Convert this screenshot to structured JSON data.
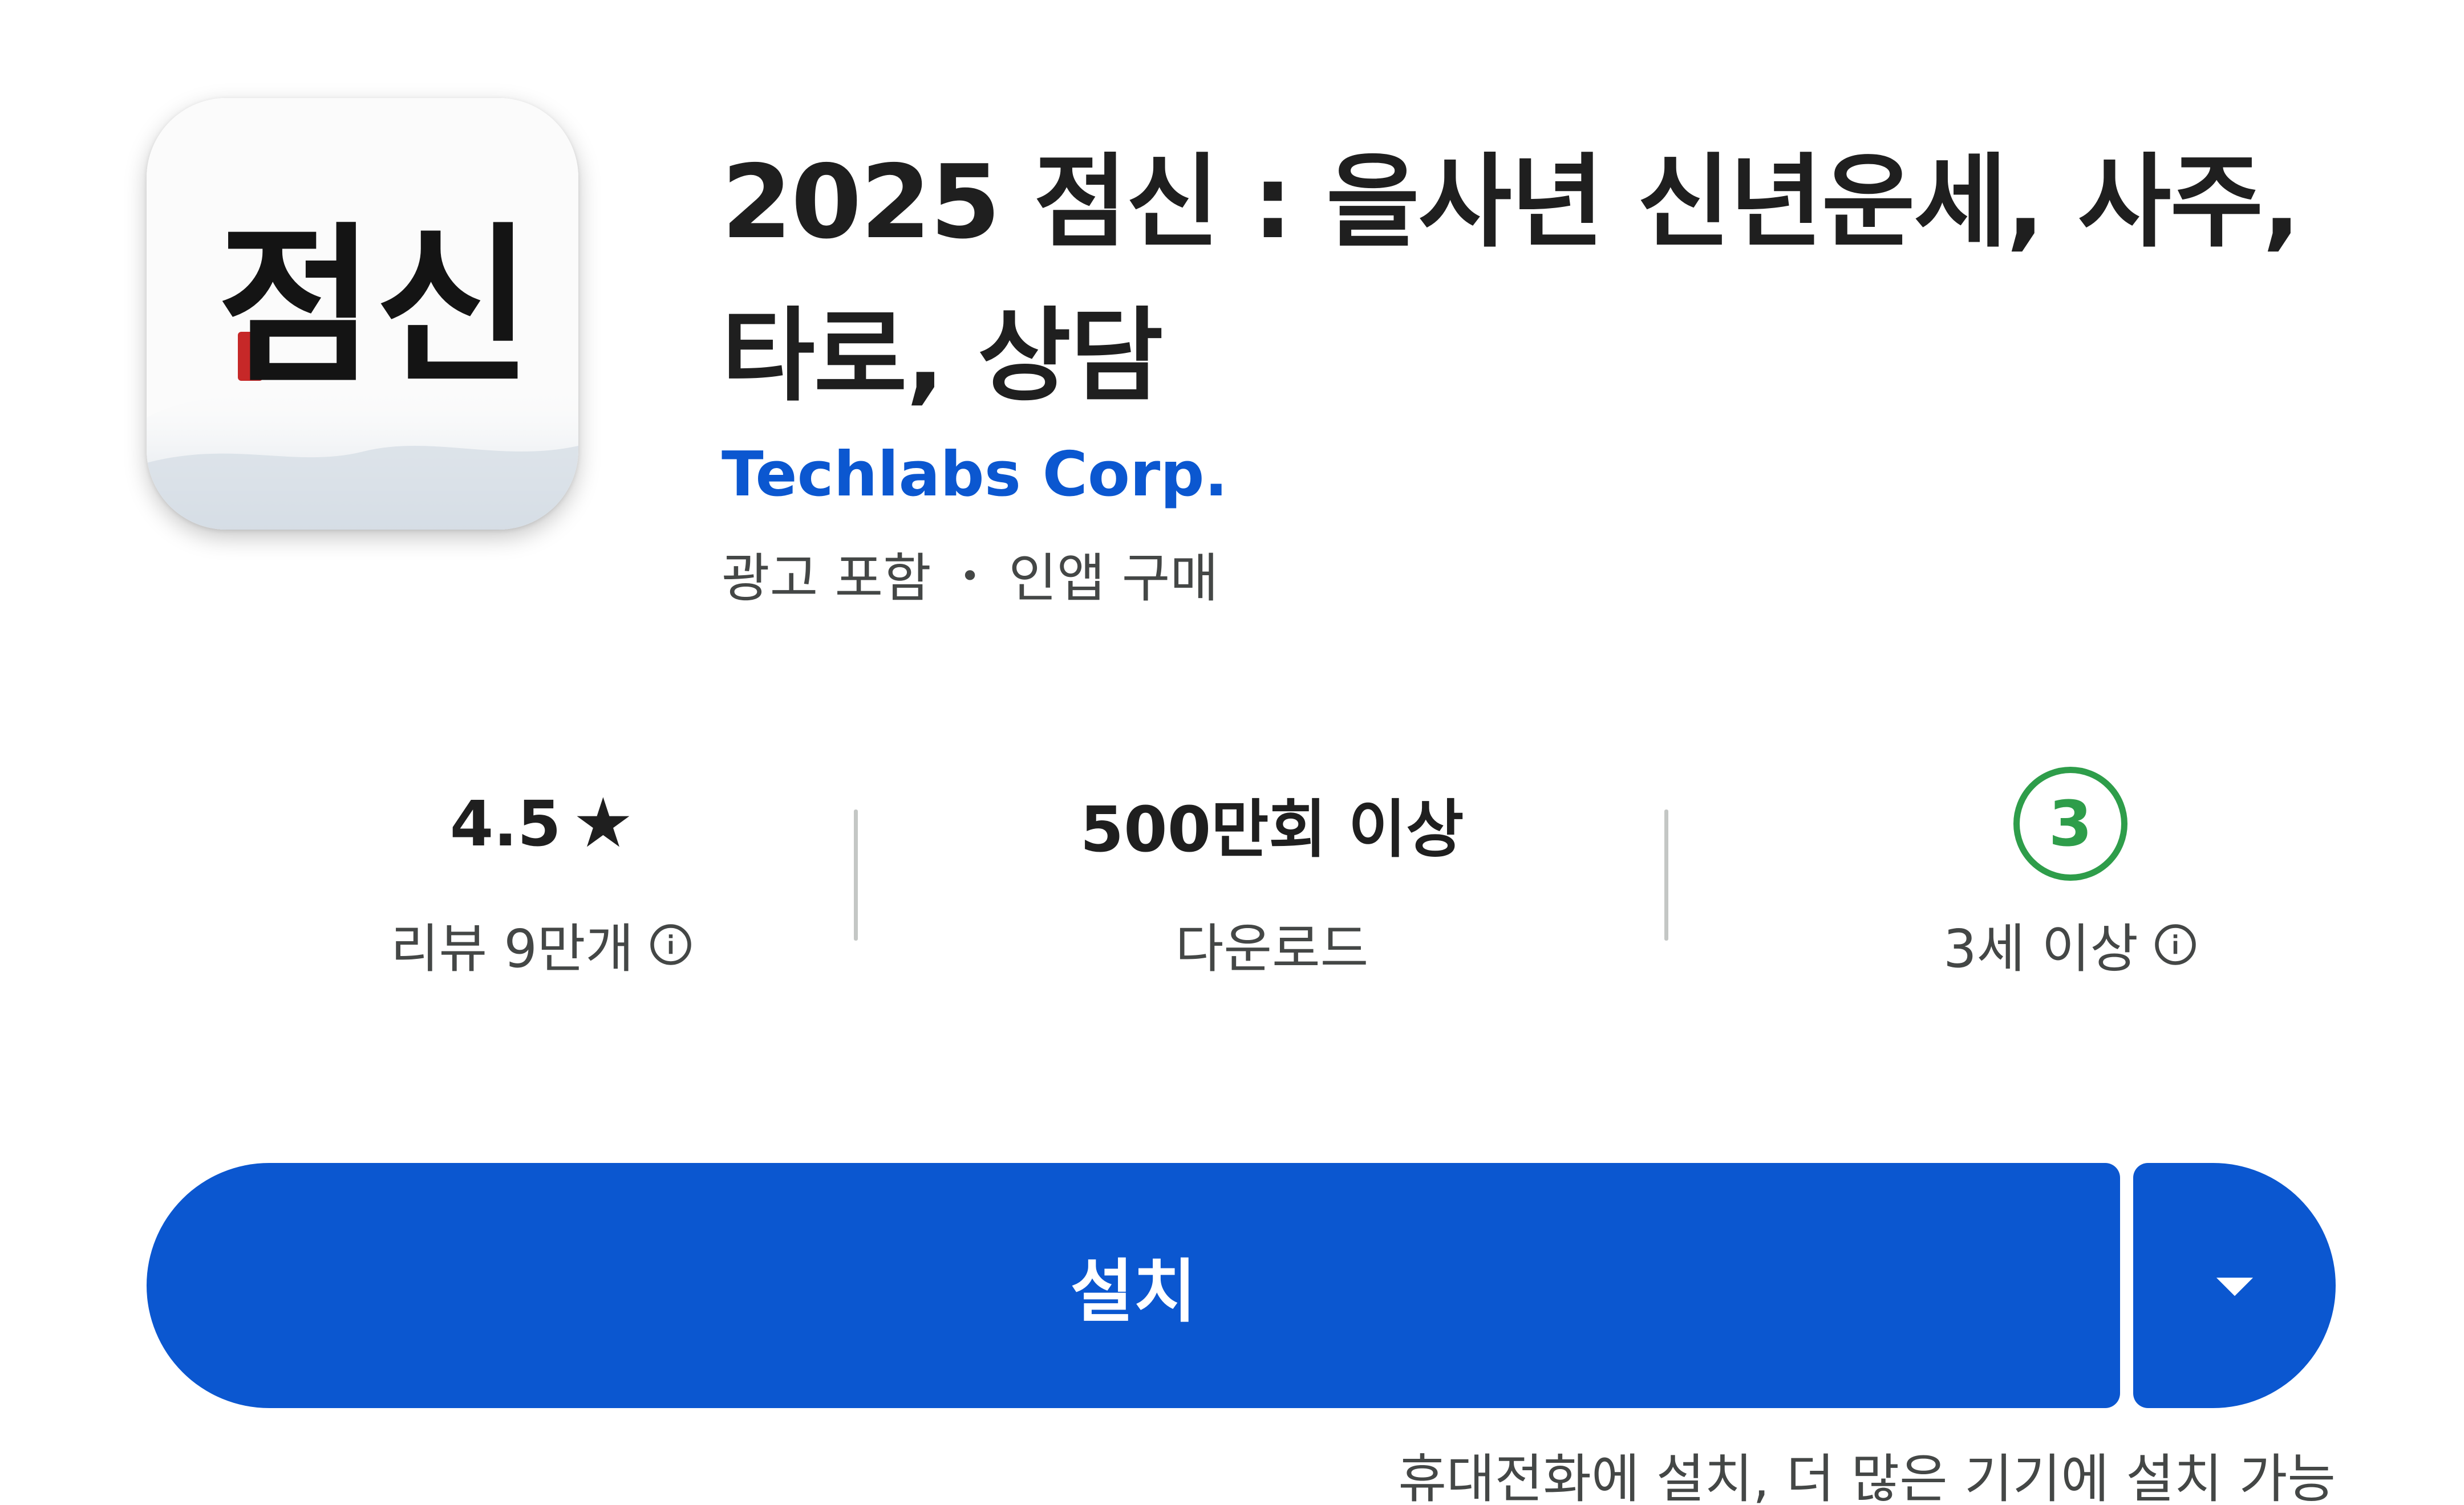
{
  "app": {
    "icon_name": "app-icon-jeomsin",
    "icon_text": "점신",
    "title": "2025 점신 : 을사년 신년운세, 사주, 타로, 상담",
    "developer": "Techlabs Corp.",
    "meta_ads": "광고 포함",
    "meta_separator": "•",
    "meta_iap": "인앱 구매"
  },
  "stats": {
    "rating_value": "4.5",
    "rating_icon": "star-icon",
    "rating_label": "리뷰 9만개",
    "downloads_value": "500만회 이상",
    "downloads_label": "다운로드",
    "age_badge": "3",
    "age_label": "3세 이상"
  },
  "actions": {
    "install_label": "설치",
    "dropdown_icon": "caret-down-icon",
    "install_note": "휴대전화에 설치, 더 많은 기기에 설치 가능"
  },
  "colors": {
    "accent": "#0b57d0",
    "age_badge": "#2e9d4a",
    "text_primary": "#1f1f1f",
    "text_secondary": "#444746",
    "seal_red": "#c62828"
  }
}
